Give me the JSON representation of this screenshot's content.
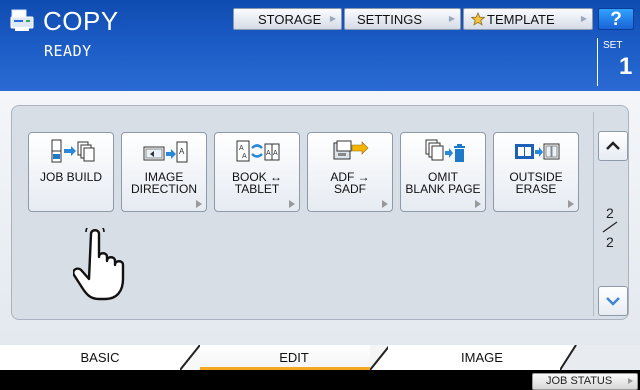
{
  "header": {
    "app_icon": "copier-icon",
    "title": "COPY",
    "status": "READY",
    "buttons": {
      "storage": "STORAGE",
      "settings": "SETTINGS",
      "template": "TEMPLATE",
      "help": "?"
    },
    "set_label": "SET",
    "set_value": "1"
  },
  "functions": [
    {
      "label": "JOB BUILD",
      "icon": "job-build-icon"
    },
    {
      "label": "IMAGE\nDIRECTION",
      "icon": "image-direction-icon"
    },
    {
      "label": "BOOK ↔\nTABLET",
      "icon": "book-tablet-icon"
    },
    {
      "label": "ADF →\nSADF",
      "icon": "adf-sadf-icon"
    },
    {
      "label": "OMIT\nBLANK PAGE",
      "icon": "omit-blank-page-icon"
    },
    {
      "label": "OUTSIDE\nERASE",
      "icon": "outside-erase-icon"
    }
  ],
  "paging": {
    "current": "2",
    "total": "2",
    "up_icon": "chevron-up-icon",
    "down_icon": "chevron-down-icon"
  },
  "tabs": {
    "basic": "BASIC",
    "edit": "EDIT",
    "image": "IMAGE",
    "active": "EDIT"
  },
  "footer": {
    "job_status": "JOB STATUS"
  },
  "colors": {
    "header_blue": "#1c5cc6",
    "active_tab_accent": "#f5a623",
    "help_button": "#1f7be6"
  }
}
